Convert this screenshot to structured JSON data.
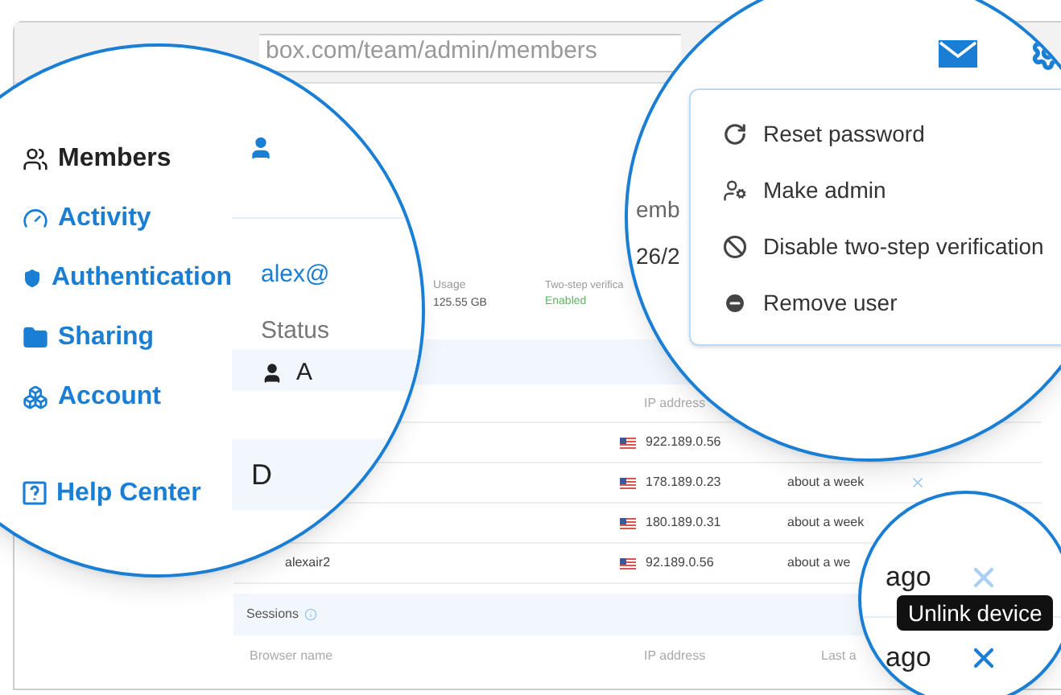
{
  "browser": {
    "url": "box.com/team/admin/members"
  },
  "sidebar": {
    "items": [
      {
        "label": "Members",
        "selected": true
      },
      {
        "label": "Activity",
        "selected": false
      },
      {
        "label": "Authentication",
        "selected": false
      },
      {
        "label": "Sharing",
        "selected": false
      },
      {
        "label": "Account",
        "selected": false
      }
    ],
    "help_link": "Help Center"
  },
  "member": {
    "email": "alex@",
    "usage_label": "Usage",
    "usage_value": "125.55 GB",
    "two_step_label": "Two-step verifica",
    "two_step_value": "Enabled",
    "status_label": "Status",
    "status_value": "A",
    "since_label": "emb",
    "since_value": "26/2",
    "devices_heading": "D"
  },
  "devices": {
    "ip_header": "IP address",
    "rows": [
      {
        "ip": "922.189.0.56"
      },
      {
        "ip": "178.189.0.23",
        "last": "about a week",
        "unlink": true
      },
      {
        "ip": "180.189.0.31",
        "last": "about a week"
      },
      {
        "name": "alexair2",
        "ip": "92.189.0.56",
        "last": "about a we"
      }
    ]
  },
  "sessions": {
    "title": "Sessions",
    "columns": [
      "Browser name",
      "IP address",
      "Last a"
    ]
  },
  "menu": {
    "items": [
      "Reset password",
      "Make admin",
      "Disable two-step verification",
      "Remove user"
    ]
  },
  "zoom": {
    "rows": [
      {
        "last": "ago",
        "hover": false
      },
      {
        "last": "ago",
        "hover": true
      }
    ],
    "tooltip": "Unlink device"
  }
}
